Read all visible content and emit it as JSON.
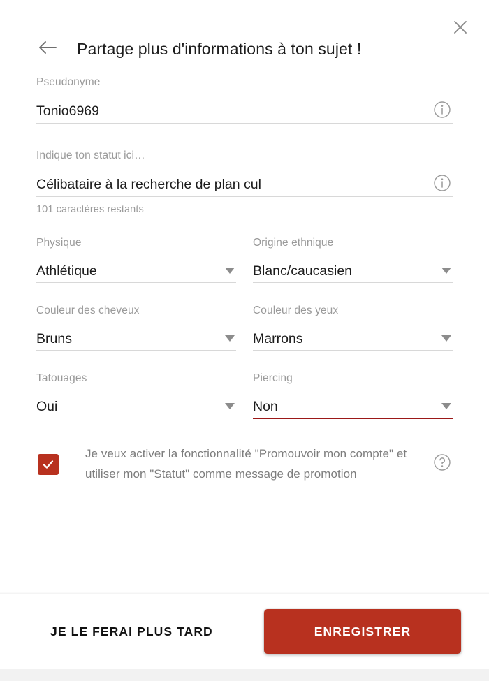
{
  "header": {
    "title": "Partage plus d'informations à ton sujet !",
    "back_icon": "arrow-left-icon",
    "close_icon": "close-icon"
  },
  "form": {
    "nickname": {
      "label": "Pseudonyme",
      "value": "Tonio6969",
      "info_icon": "info-circle-icon"
    },
    "status": {
      "label": "Indique ton statut ici…",
      "value": "Célibataire à la recherche de plan cul",
      "helper": "101 caractères restants",
      "info_icon": "info-circle-icon"
    },
    "body_type": {
      "label": "Physique",
      "value": "Athlétique"
    },
    "ethnicity": {
      "label": "Origine ethnique",
      "value": "Blanc/caucasien"
    },
    "hair_color": {
      "label": "Couleur des cheveux",
      "value": "Bruns"
    },
    "eye_color": {
      "label": "Couleur des yeux",
      "value": "Marrons"
    },
    "tattoos": {
      "label": "Tatouages",
      "value": "Oui"
    },
    "piercing": {
      "label": "Piercing",
      "value": "Non",
      "state": "active"
    },
    "promote": {
      "text": "Je veux activer la fonctionnalité \"Promouvoir mon compte\" et utiliser mon \"Statut\" comme message de promotion",
      "checked": true,
      "help_icon": "help-circle-icon"
    }
  },
  "footer": {
    "later_label": "JE LE FERAI PLUS TARD",
    "save_label": "ENREGISTRER"
  },
  "colors": {
    "accent": "#b8311f",
    "active_underline": "#9b1818",
    "label_gray": "#9a9a9a",
    "value_dark": "#1d1d1d",
    "divider": "#d8d8d8",
    "page_bg": "#f2f2f2"
  }
}
